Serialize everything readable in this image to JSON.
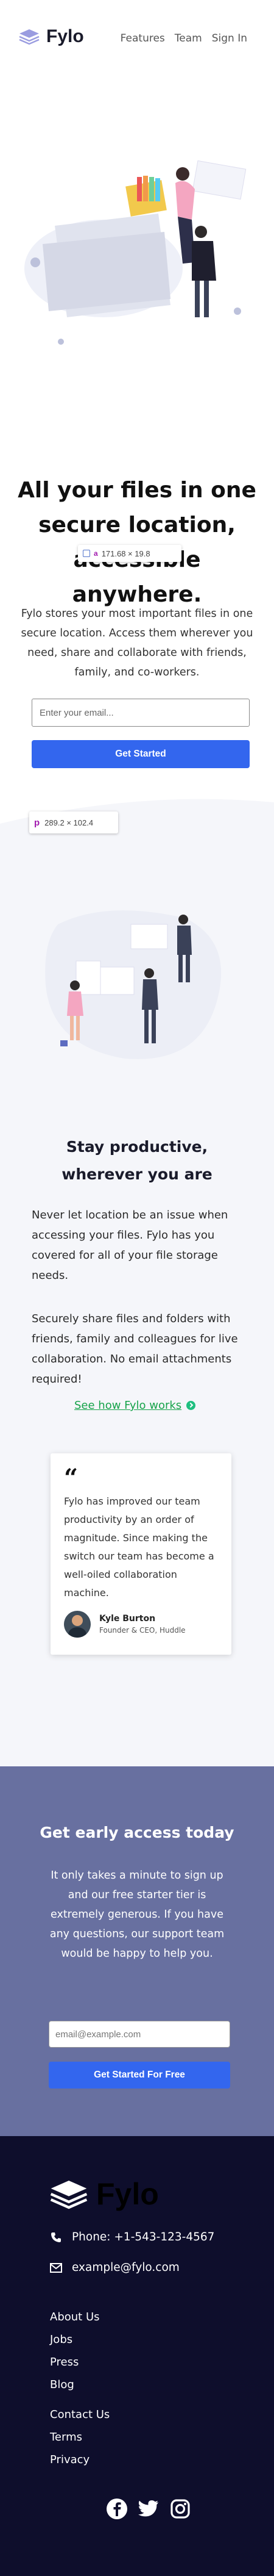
{
  "header": {
    "brand": "Fylo",
    "nav": [
      "Features",
      "Team",
      "Sign In"
    ]
  },
  "hero": {
    "title": "All your files in one secure location, accessible anywhere.",
    "measure_label": "171.68 × 19.8",
    "description": "Fylo stores your most important files in one secure location. Access them wherever you need, share and collaborate with friends, family, and co-workers.",
    "email_placeholder": "Enter your email...",
    "cta": "Get Started"
  },
  "productive": {
    "measure_label": "289.2 × 102.4",
    "title": "Stay productive, wherever you are",
    "paragraph_1": "Never let location be an issue when accessing your files. Fylo has you covered for all of your file storage needs.",
    "paragraph_2": "Securely share files and folders with friends, family and colleagues for live collaboration. No email attachments required!",
    "link": "See how Fylo works",
    "testimonial": {
      "quote": "Fylo has improved our team productivity by an order of magnitude. Since making the switch our team has become a well-oiled collaboration machine.",
      "name": "Kyle Burton",
      "role": "Founder & CEO, Huddle"
    }
  },
  "early_access": {
    "title": "Get early access today",
    "description": "It only takes a minute to sign up and our free starter tier is extremely generous. If you have any questions, our support team would be happy to help you.",
    "email_placeholder": "email@example.com",
    "cta": "Get Started For Free"
  },
  "footer": {
    "brand": "Fylo",
    "phone": "Phone: +1-543-123-4567",
    "email": "example@fylo.com",
    "links_col1": [
      "About Us",
      "Jobs",
      "Press",
      "Blog"
    ],
    "links_col2": [
      "Contact Us",
      "Terms",
      "Privacy"
    ],
    "socials": [
      "facebook-icon",
      "twitter-icon",
      "instagram-icon"
    ]
  },
  "colors": {
    "accent": "#3366ee",
    "link_green": "#16a34a",
    "early_bg": "#6870a0",
    "footer_bg": "#0e0e2c"
  }
}
